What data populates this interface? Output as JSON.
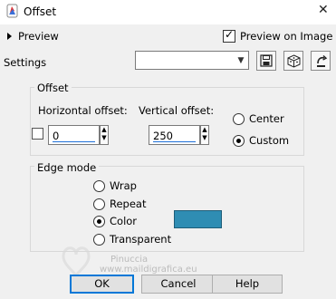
{
  "window": {
    "title": "Offset"
  },
  "preview": {
    "label": "Preview",
    "on_image_label": "Preview on Image",
    "on_image_checked": true
  },
  "settings": {
    "label": "Settings",
    "value": ""
  },
  "offset": {
    "group_title": "Offset",
    "horizontal_label": "Horizontal offset:",
    "horizontal_value": "0",
    "vertical_label": "Vertical offset:",
    "vertical_value": "250",
    "center_label": "Center",
    "custom_label": "Custom",
    "selected": "Custom"
  },
  "edge_mode": {
    "group_title": "Edge mode",
    "options": [
      "Wrap",
      "Repeat",
      "Color",
      "Transparent"
    ],
    "selected": "Color",
    "color": "#2f8db3"
  },
  "watermark": {
    "line1": "Pinuccia",
    "line2": "www.maildigrafica.eu"
  },
  "buttons": {
    "ok": "OK",
    "cancel": "Cancel",
    "help": "Help"
  }
}
